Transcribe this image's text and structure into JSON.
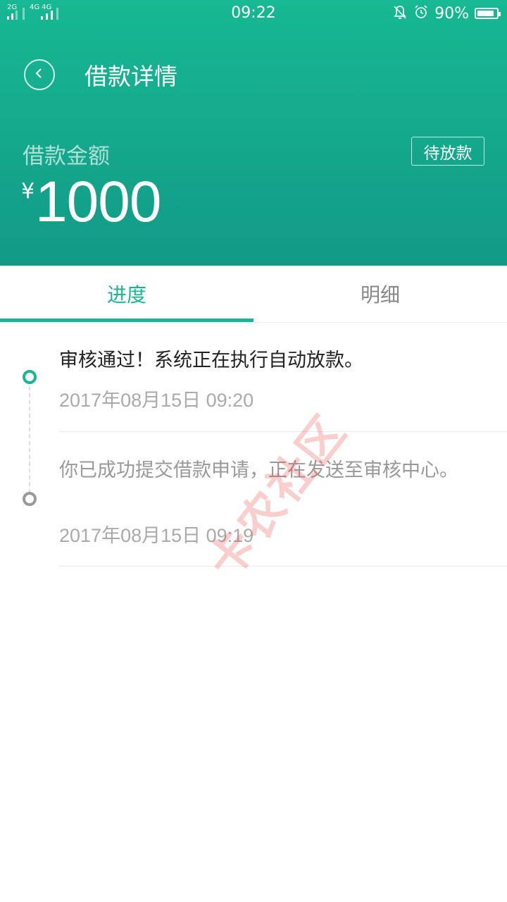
{
  "status_bar": {
    "sim1_label": "2G",
    "sim2_label": "4G 4G",
    "time": "09:22",
    "battery_percent": "90%",
    "battery_level": 0.9,
    "icons": [
      "mute-bell-icon",
      "alarm-icon",
      "battery-icon"
    ]
  },
  "header": {
    "title": "借款详情",
    "amount_label": "借款金额",
    "status_badge": "待放款",
    "currency_symbol": "¥",
    "amount": "1000",
    "colors": {
      "gradient_top": "#17b893",
      "gradient_bottom": "#129a86"
    }
  },
  "tabs": [
    {
      "label": "进度",
      "active": true
    },
    {
      "label": "明细",
      "active": false
    }
  ],
  "timeline": [
    {
      "title": "审核通过！系统正在执行自动放款。",
      "time": "2017年08月15日 09:20",
      "active": true
    },
    {
      "title": "你已成功提交借款申请，正在发送至审核中心。",
      "time": "2017年08月15日 09:19",
      "active": false
    }
  ],
  "watermark": "卡农社区",
  "accent_color": "#1db495"
}
